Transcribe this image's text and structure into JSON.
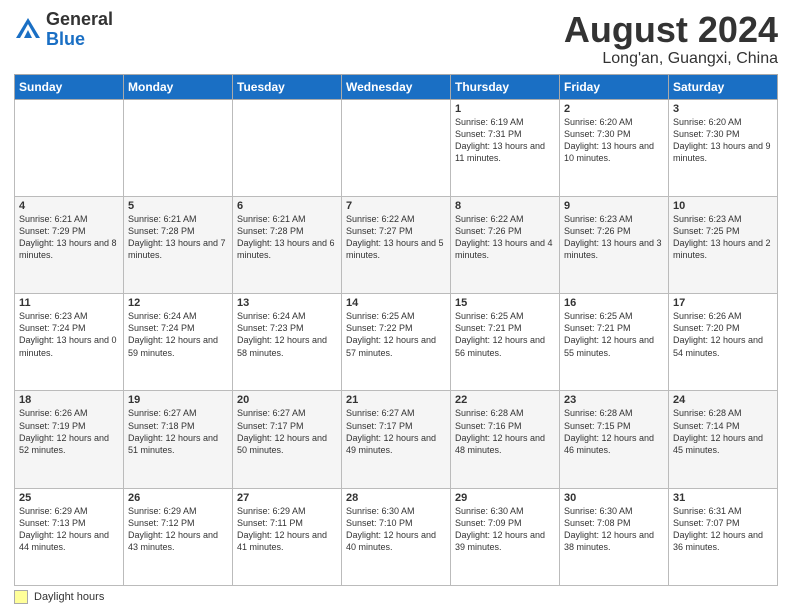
{
  "header": {
    "logo_general": "General",
    "logo_blue": "Blue",
    "main_title": "August 2024",
    "subtitle": "Long'an, Guangxi, China"
  },
  "legend": {
    "box_label": "Daylight hours"
  },
  "days_of_week": [
    "Sunday",
    "Monday",
    "Tuesday",
    "Wednesday",
    "Thursday",
    "Friday",
    "Saturday"
  ],
  "weeks": [
    [
      {
        "day": "",
        "info": ""
      },
      {
        "day": "",
        "info": ""
      },
      {
        "day": "",
        "info": ""
      },
      {
        "day": "",
        "info": ""
      },
      {
        "day": "1",
        "info": "Sunrise: 6:19 AM\nSunset: 7:31 PM\nDaylight: 13 hours and 11 minutes."
      },
      {
        "day": "2",
        "info": "Sunrise: 6:20 AM\nSunset: 7:30 PM\nDaylight: 13 hours and 10 minutes."
      },
      {
        "day": "3",
        "info": "Sunrise: 6:20 AM\nSunset: 7:30 PM\nDaylight: 13 hours and 9 minutes."
      }
    ],
    [
      {
        "day": "4",
        "info": "Sunrise: 6:21 AM\nSunset: 7:29 PM\nDaylight: 13 hours and 8 minutes."
      },
      {
        "day": "5",
        "info": "Sunrise: 6:21 AM\nSunset: 7:28 PM\nDaylight: 13 hours and 7 minutes."
      },
      {
        "day": "6",
        "info": "Sunrise: 6:21 AM\nSunset: 7:28 PM\nDaylight: 13 hours and 6 minutes."
      },
      {
        "day": "7",
        "info": "Sunrise: 6:22 AM\nSunset: 7:27 PM\nDaylight: 13 hours and 5 minutes."
      },
      {
        "day": "8",
        "info": "Sunrise: 6:22 AM\nSunset: 7:26 PM\nDaylight: 13 hours and 4 minutes."
      },
      {
        "day": "9",
        "info": "Sunrise: 6:23 AM\nSunset: 7:26 PM\nDaylight: 13 hours and 3 minutes."
      },
      {
        "day": "10",
        "info": "Sunrise: 6:23 AM\nSunset: 7:25 PM\nDaylight: 13 hours and 2 minutes."
      }
    ],
    [
      {
        "day": "11",
        "info": "Sunrise: 6:23 AM\nSunset: 7:24 PM\nDaylight: 13 hours and 0 minutes."
      },
      {
        "day": "12",
        "info": "Sunrise: 6:24 AM\nSunset: 7:24 PM\nDaylight: 12 hours and 59 minutes."
      },
      {
        "day": "13",
        "info": "Sunrise: 6:24 AM\nSunset: 7:23 PM\nDaylight: 12 hours and 58 minutes."
      },
      {
        "day": "14",
        "info": "Sunrise: 6:25 AM\nSunset: 7:22 PM\nDaylight: 12 hours and 57 minutes."
      },
      {
        "day": "15",
        "info": "Sunrise: 6:25 AM\nSunset: 7:21 PM\nDaylight: 12 hours and 56 minutes."
      },
      {
        "day": "16",
        "info": "Sunrise: 6:25 AM\nSunset: 7:21 PM\nDaylight: 12 hours and 55 minutes."
      },
      {
        "day": "17",
        "info": "Sunrise: 6:26 AM\nSunset: 7:20 PM\nDaylight: 12 hours and 54 minutes."
      }
    ],
    [
      {
        "day": "18",
        "info": "Sunrise: 6:26 AM\nSunset: 7:19 PM\nDaylight: 12 hours and 52 minutes."
      },
      {
        "day": "19",
        "info": "Sunrise: 6:27 AM\nSunset: 7:18 PM\nDaylight: 12 hours and 51 minutes."
      },
      {
        "day": "20",
        "info": "Sunrise: 6:27 AM\nSunset: 7:17 PM\nDaylight: 12 hours and 50 minutes."
      },
      {
        "day": "21",
        "info": "Sunrise: 6:27 AM\nSunset: 7:17 PM\nDaylight: 12 hours and 49 minutes."
      },
      {
        "day": "22",
        "info": "Sunrise: 6:28 AM\nSunset: 7:16 PM\nDaylight: 12 hours and 48 minutes."
      },
      {
        "day": "23",
        "info": "Sunrise: 6:28 AM\nSunset: 7:15 PM\nDaylight: 12 hours and 46 minutes."
      },
      {
        "day": "24",
        "info": "Sunrise: 6:28 AM\nSunset: 7:14 PM\nDaylight: 12 hours and 45 minutes."
      }
    ],
    [
      {
        "day": "25",
        "info": "Sunrise: 6:29 AM\nSunset: 7:13 PM\nDaylight: 12 hours and 44 minutes."
      },
      {
        "day": "26",
        "info": "Sunrise: 6:29 AM\nSunset: 7:12 PM\nDaylight: 12 hours and 43 minutes."
      },
      {
        "day": "27",
        "info": "Sunrise: 6:29 AM\nSunset: 7:11 PM\nDaylight: 12 hours and 41 minutes."
      },
      {
        "day": "28",
        "info": "Sunrise: 6:30 AM\nSunset: 7:10 PM\nDaylight: 12 hours and 40 minutes."
      },
      {
        "day": "29",
        "info": "Sunrise: 6:30 AM\nSunset: 7:09 PM\nDaylight: 12 hours and 39 minutes."
      },
      {
        "day": "30",
        "info": "Sunrise: 6:30 AM\nSunset: 7:08 PM\nDaylight: 12 hours and 38 minutes."
      },
      {
        "day": "31",
        "info": "Sunrise: 6:31 AM\nSunset: 7:07 PM\nDaylight: 12 hours and 36 minutes."
      }
    ]
  ]
}
